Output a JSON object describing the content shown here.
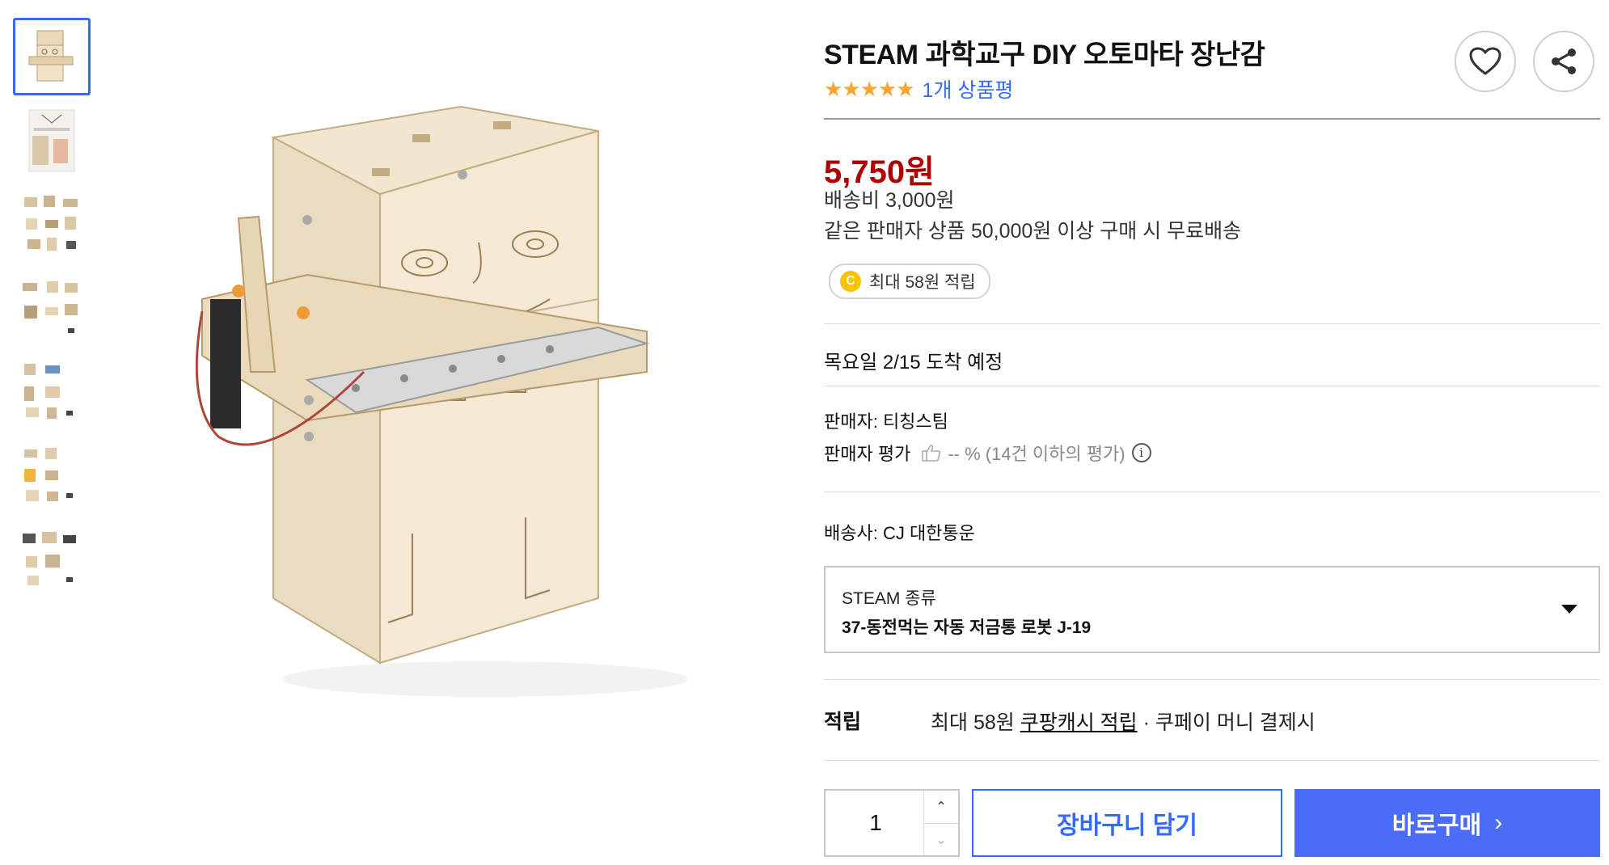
{
  "product": {
    "title": "STEAM 과학교구 DIY 오토마타 장난감",
    "stars": "★★★★★",
    "review_count_label": "1개 상품평"
  },
  "pricing": {
    "price": "5,750원",
    "shipping_fee": "배송비 3,000원",
    "free_shipping_note": "같은 판매자 상품 50,000원 이상 구매 시 무료배송",
    "cash_icon": "C",
    "cash_badge": "최대 58원 적립"
  },
  "delivery": {
    "date": "목요일 2/15",
    "suffix": " 도착 예정"
  },
  "seller": {
    "name_label": "판매자: 티칭스팀",
    "rating_label": "판매자 평가",
    "rating_value": "-- % (14건 이하의 평가)",
    "info_icon": "i"
  },
  "carrier": {
    "label": "배송사: CJ 대한통운"
  },
  "option": {
    "label": "STEAM 종류",
    "value": "37-동전먹는 자동 저금통 로봇 J-19"
  },
  "points": {
    "label": "적립",
    "prefix": "최대 58원 ",
    "link": "쿠팡캐시 적립",
    "suffix": " · 쿠페이 머니 결제시"
  },
  "purchase": {
    "quantity": "1",
    "up_arrow": "⌃",
    "down_arrow": "⌄",
    "cart_label": "장바구니 담기",
    "buy_label": "바로구매",
    "buy_chevron": "›"
  },
  "colors": {
    "accent_blue": "#346aff",
    "price_red": "#ae0000",
    "star_orange": "#f6a530"
  },
  "icons": {
    "wishlist": "heart-icon",
    "share": "share-icon"
  }
}
